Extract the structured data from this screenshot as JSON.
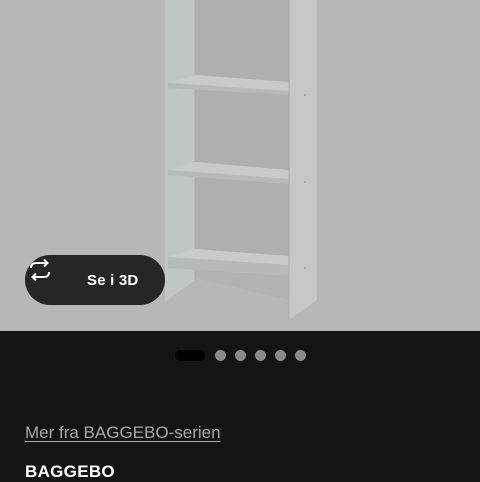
{
  "gallery": {
    "view_3d_label": "Se i 3D",
    "view_3d_icon": "rotate-arrows-icon",
    "dots": [
      {
        "active": true
      },
      {
        "active": false
      },
      {
        "active": false
      },
      {
        "active": false
      },
      {
        "active": false
      },
      {
        "active": false
      }
    ]
  },
  "product": {
    "series_link": "Mer fra BAGGEBO-serien",
    "name": "BAGGEBO"
  },
  "colors": {
    "hero_background": "#b7b7b7",
    "page_background": "#141414",
    "button_background": "#262626",
    "link_text": "#a8a8a8"
  }
}
